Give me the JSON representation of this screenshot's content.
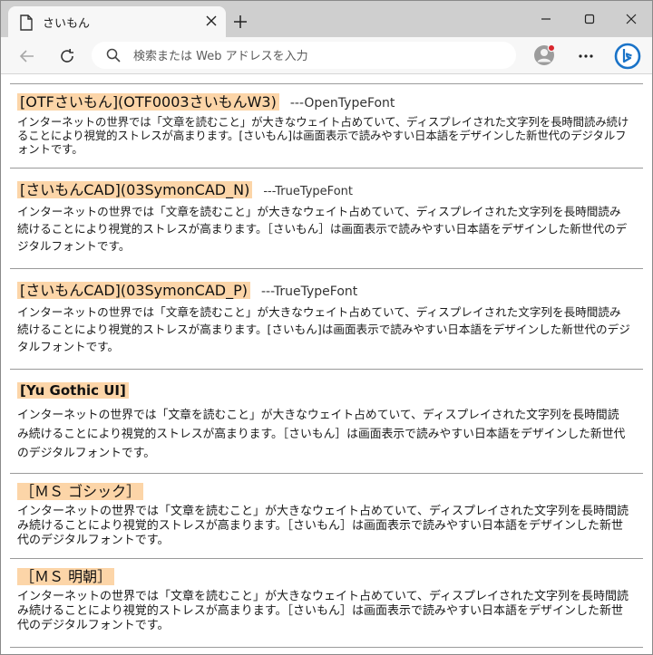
{
  "browser": {
    "tab_title": "さいもん",
    "address_placeholder": "検索または Web アドレスを入力",
    "colors": {
      "tabstrip": "#cfcfcf",
      "toolbar": "#f7f7f7",
      "highlight": "#fcd5a8",
      "profile_dot": "#d9262d",
      "bing_blue": "#1a73c8"
    }
  },
  "sections": [
    {
      "name": "[OTFさいもん](OTF0003さいもんW3)",
      "type": "---OpenTypeFont",
      "text": "インターネットの世界では「文章を読むこと」が大きなウェイト占めていて、ディスプレイされた文字列を長時間読み続けることにより視覚的ストレスが高まります。[さいもん]は画面表示で読みやすい日本語をデザインした新世代のデジタルフォントです。"
    },
    {
      "name": "[さいもんCAD](03SymonCAD_N)",
      "type": "---TrueTypeFont",
      "text": "インターネットの世界では「文章を読むこと」が大きなウェイト占めていて、ディスプレイされた文字列を長時間読み続けることにより視覚的ストレスが高まります。［さいもん］は画面表示で読みやすい日本語をデザインした新世代のデジタルフォントです。"
    },
    {
      "name": "[さいもんCAD](03SymonCAD_P)",
      "type": "---TrueTypeFont",
      "text": "インターネットの世界では「文章を読むこと」が大きなウェイト占めていて、ディスプレイされた文字列を長時間読み続けることにより視覚的ストレスが高まります。[さいもん]は画面表示で読みやすい日本語をデザインした新世代のデジタルフォントです。"
    },
    {
      "name": "[Yu Gothic UI]",
      "type": "",
      "text": "インターネットの世界では「文章を読むこと」が大きなウェイト占めていて、ディスプレイされた文字列を長時間読み続けることにより視覚的ストレスが高まります。［さいもん］は画面表示で読みやすい日本語をデザインした新世代のデジタルフォントです。"
    },
    {
      "name": "［ＭＳ ゴシック］",
      "type": "",
      "text": "インターネットの世界では「文章を読むこと」が大きなウェイト占めていて、ディスプレイされた文字列を長時間読み続けることにより視覚的ストレスが高まります。［さいもん］は画面表示で読みやすい日本語をデザインした新世代のデジタルフォントです。"
    },
    {
      "name": "［ＭＳ 明朝］",
      "type": "",
      "text": "インターネットの世界では「文章を読むこと」が大きなウェイト占めていて、ディスプレイされた文字列を長時間読み続けることにより視覚的ストレスが高まります。［さいもん］は画面表示で読みやすい日本語をデザインした新世代のデジタルフォントです。"
    }
  ]
}
